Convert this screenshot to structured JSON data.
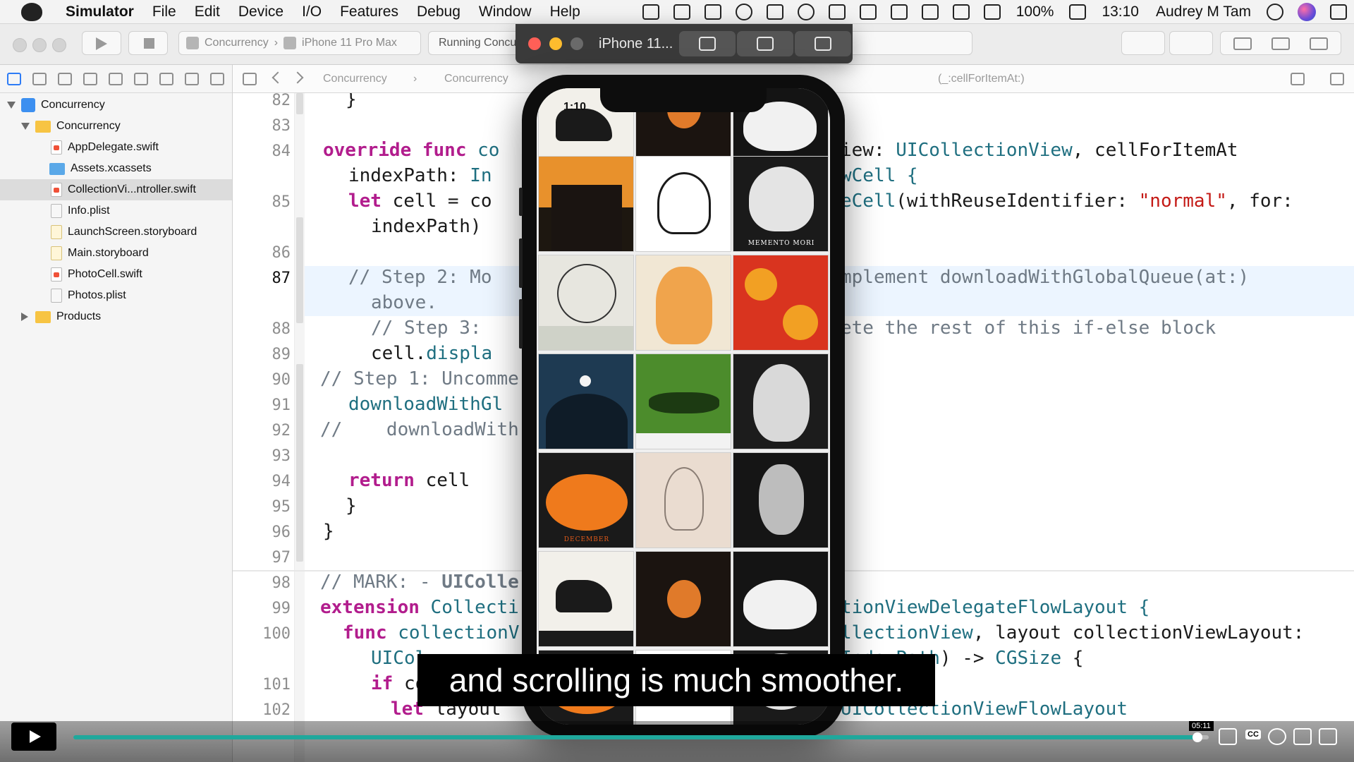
{
  "menubar": {
    "app_name": "Simulator",
    "items": [
      "File",
      "Edit",
      "Device",
      "I/O",
      "Features",
      "Debug",
      "Window",
      "Help"
    ],
    "battery": "100%",
    "clock": "13:10",
    "user": "Audrey M Tam"
  },
  "toolbar": {
    "scheme": "Concurrency",
    "device": "iPhone 11 Pro Max",
    "status": "Running Concurrency on iPhone 11 Pro Max"
  },
  "navigator": {
    "items": [
      {
        "label": "Concurrency",
        "kind": "project"
      },
      {
        "label": "Concurrency",
        "kind": "folder"
      },
      {
        "label": "AppDelegate.swift",
        "kind": "swift"
      },
      {
        "label": "Assets.xcassets",
        "kind": "assets"
      },
      {
        "label": "CollectionVi...ntroller.swift",
        "kind": "swift",
        "selected": true
      },
      {
        "label": "Info.plist",
        "kind": "plist"
      },
      {
        "label": "LaunchScreen.storyboard",
        "kind": "storyboard"
      },
      {
        "label": "Main.storyboard",
        "kind": "storyboard"
      },
      {
        "label": "PhotoCell.swift",
        "kind": "swift"
      },
      {
        "label": "Photos.plist",
        "kind": "plist"
      },
      {
        "label": "Products",
        "kind": "folder"
      }
    ]
  },
  "jumpbar": {
    "crumb1": "Concurrency",
    "crumb2": "Concurrency",
    "crumb3": "(_:cellForItemAt:)"
  },
  "editor": {
    "line_numbers": [
      "82",
      "83",
      "84",
      "85",
      "86",
      "87",
      "88",
      "89",
      "90",
      "91",
      "92",
      "93",
      "94",
      "95",
      "96",
      "97",
      "98",
      "99",
      "100",
      "101",
      "102"
    ],
    "current_line": "87"
  },
  "simulator": {
    "title": "iPhone 11...",
    "status_time": "1:10"
  },
  "tiles": {
    "skull_caption": "MEMENTO MORI",
    "cat_caption": "DECEMBER"
  },
  "video": {
    "caption": "and scrolling is much smoother.",
    "progress": 0.99,
    "time": "05:11"
  },
  "colors": {
    "keyword": "#b21d8d",
    "type": "#1f6f80",
    "comment": "#6f7a85",
    "string": "#c41a16",
    "progress": "#1fa89c",
    "accent": "#2e7cf6"
  }
}
